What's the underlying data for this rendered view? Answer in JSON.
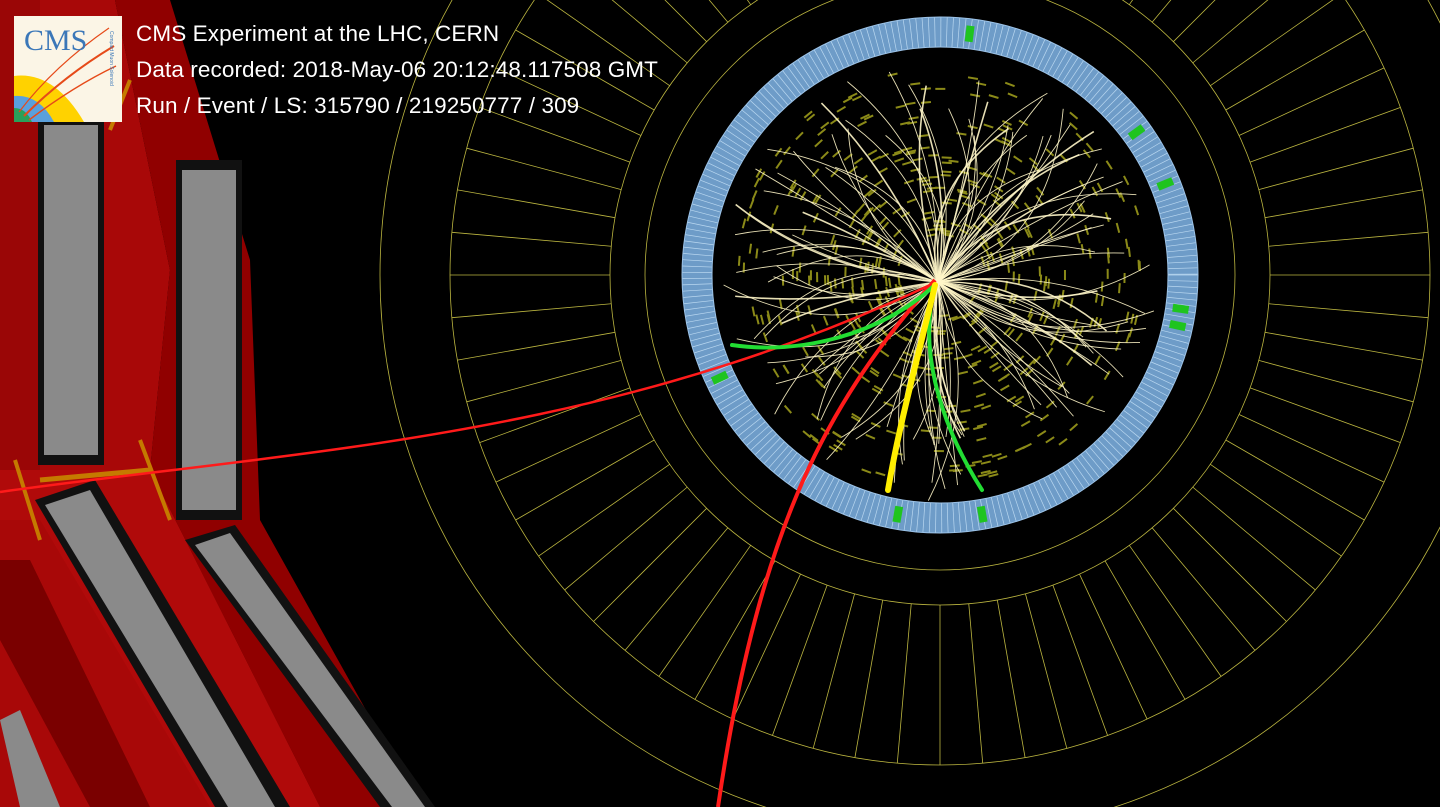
{
  "logo": {
    "text": "CMS",
    "subtext": "Compact Muon Solenoid"
  },
  "info": {
    "title": "CMS Experiment at the LHC, CERN",
    "recorded": "Data recorded: 2018-May-06 20:12:48.117508 GMT",
    "run": "Run / Event / LS: 315790 / 219250777 / 309"
  },
  "colors": {
    "background": "#000000",
    "muon_chamber": "#c00000",
    "steel": "#7f7f7f",
    "ecal": "#8fb6dc",
    "hcal_lines": "#c9c24b",
    "track": "#fff6c8",
    "muon_track": "#ff2020",
    "electron_track": "#22dd33",
    "highlight_track": "#ffee00"
  },
  "icons": [
    "cms-logo-icon"
  ]
}
